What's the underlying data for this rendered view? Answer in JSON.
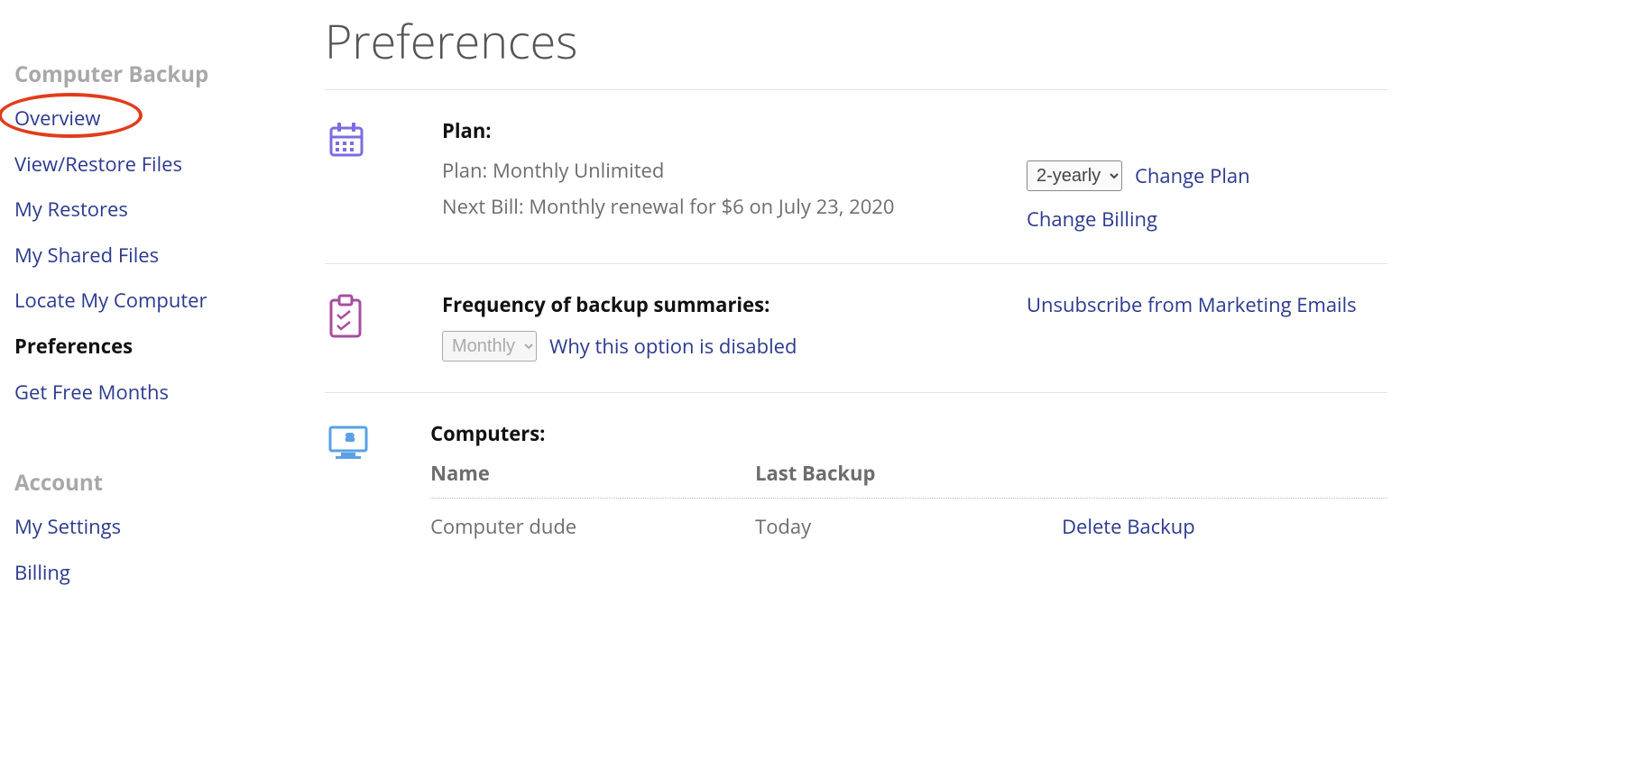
{
  "sidebar": {
    "sections": [
      {
        "title": "Computer Backup",
        "items": [
          {
            "label": "Overview",
            "active": false,
            "circled": true
          },
          {
            "label": "View/Restore Files",
            "active": false
          },
          {
            "label": "My Restores",
            "active": false
          },
          {
            "label": "My Shared Files",
            "active": false
          },
          {
            "label": "Locate My Computer",
            "active": false
          },
          {
            "label": "Preferences",
            "active": true
          },
          {
            "label": "Get Free Months",
            "active": false
          }
        ]
      },
      {
        "title": "Account",
        "items": [
          {
            "label": "My Settings",
            "active": false
          },
          {
            "label": "Billing",
            "active": false
          }
        ]
      }
    ]
  },
  "page": {
    "title": "Preferences"
  },
  "plan": {
    "heading": "Plan:",
    "plan_line": "Plan: Monthly Unlimited",
    "next_bill_line": "Next Bill: Monthly renewal for $6 on July 23, 2020",
    "cycle_select": {
      "selected": "2-yearly",
      "options": [
        "2-yearly"
      ]
    },
    "change_plan": "Change Plan",
    "change_billing": "Change Billing"
  },
  "frequency": {
    "heading": "Frequency of backup summaries:",
    "freq_select": {
      "selected": "Monthly",
      "options": [
        "Monthly"
      ],
      "disabled": true
    },
    "why_disabled": "Why this option is disabled",
    "unsubscribe": "Unsubscribe from Marketing Emails"
  },
  "computers": {
    "heading": "Computers:",
    "columns": {
      "name": "Name",
      "last": "Last Backup",
      "action": ""
    },
    "rows": [
      {
        "name": "Computer dude",
        "last": "Today",
        "action": "Delete Backup"
      }
    ]
  }
}
